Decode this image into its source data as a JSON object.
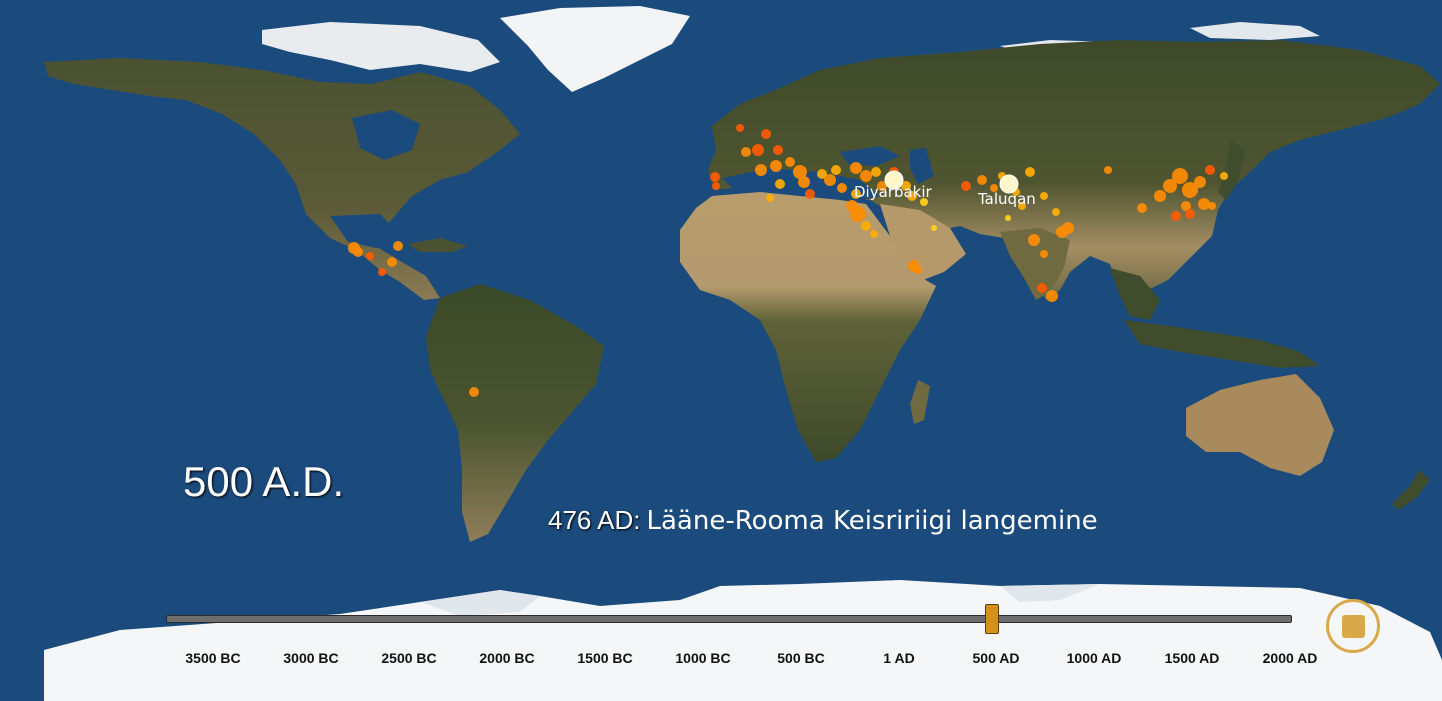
{
  "map": {
    "ocean_color": "#1b4a7c",
    "land_forest_color": "#3d4a2a",
    "land_desert_color": "#b39a6e",
    "ice_color": "#f4f6f8",
    "marker_colors": [
      "#ff5a00",
      "#ff8c00",
      "#ffae00",
      "#ffd21a"
    ],
    "highlight_marker_color": "#fff6cc"
  },
  "labels": {
    "year": "500 A.D.",
    "event_date": "476 AD:",
    "event_text": "Lääne-Rooma Keisririigi langemine",
    "cities": [
      {
        "id": "diyarbakir",
        "name": "Diyarbakir"
      },
      {
        "id": "taluqan",
        "name": "Taluqan"
      }
    ]
  },
  "timeline": {
    "ticks": [
      "3500 BC",
      "3000 BC",
      "2500 BC",
      "2000 BC",
      "1500 BC",
      "1000 BC",
      "500 BC",
      "1 AD",
      "500 AD",
      "1000 AD",
      "1500 AD",
      "2000 AD"
    ],
    "current": "500 AD",
    "play_icon": "stop-square-icon"
  }
}
